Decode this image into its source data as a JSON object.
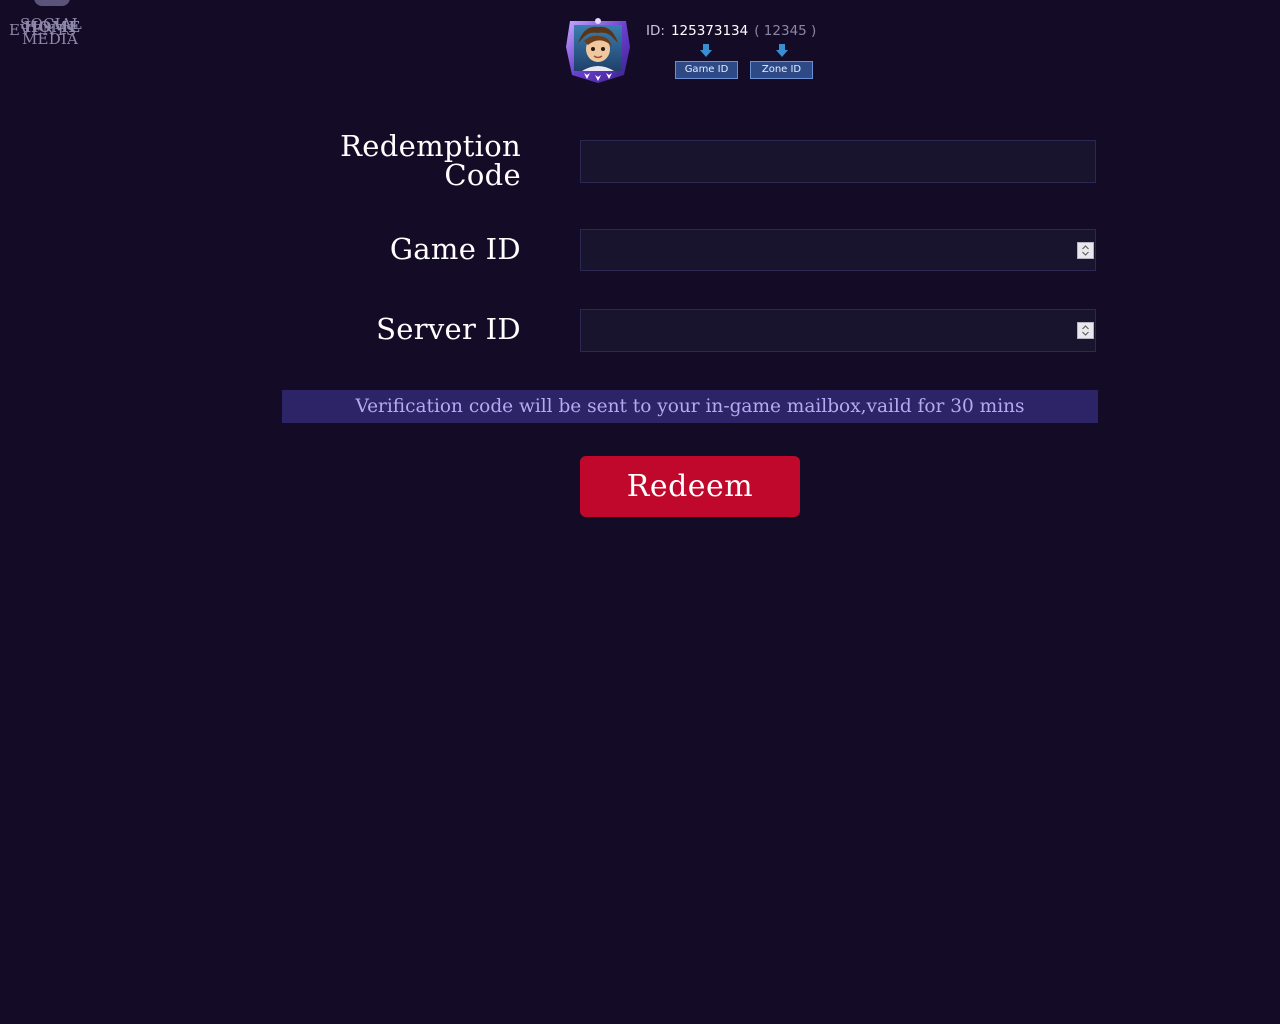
{
  "nav": {
    "social": "SOCIAL",
    "events": "EVENTS",
    "home": "HOME",
    "media": "MEDIA"
  },
  "id_hint": {
    "prefix": "ID:",
    "game_id": "125373134",
    "zone_id": "( 12345 )",
    "game_badge": "Game ID",
    "zone_badge": "Zone ID"
  },
  "form": {
    "redemption_label": "Redemption Code",
    "redemption_value": "",
    "game_id_label": "Game ID",
    "game_id_value": "",
    "server_id_label": "Server ID",
    "server_id_value": ""
  },
  "notice": "Verification code will be sent to your in-game mailbox,vaild for 30 mins",
  "redeem_button": "Redeem",
  "colors": {
    "background": "#140c26",
    "accent_button": "#c0082c",
    "notice_bg": "#2c2466",
    "notice_text": "#b4aaf4",
    "badge_bg": "#2e4a86"
  },
  "icons": {
    "avatar": "hero-avatar-frame",
    "arrows": "arrow-down-icon",
    "spinner": "number-spinner-icon"
  }
}
